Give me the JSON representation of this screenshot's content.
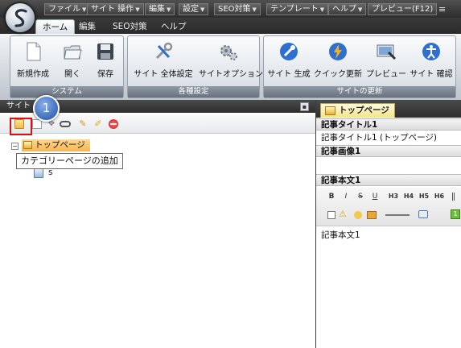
{
  "titlebar": {
    "menus": [
      "ファイル",
      "サイト 操作",
      "編集",
      "設定",
      "SEO対策",
      "テンプレート",
      "ヘルプ",
      "プレビュー(F12)"
    ],
    "overflow": "≡"
  },
  "ribbon_tabs": [
    "ホーム",
    "編集",
    "SEO対策",
    "ヘルプ"
  ],
  "ribbon": {
    "groups": [
      {
        "caption": "システム",
        "buttons": [
          "新規作成",
          "開く",
          "保存"
        ]
      },
      {
        "caption": "各種設定",
        "buttons": [
          "サイト 全体設定",
          "サイトオプション"
        ]
      },
      {
        "caption": "サイトの更新",
        "buttons": [
          "サイト 生成",
          "クイック更新",
          "プレビュー",
          "サイト 確認"
        ]
      }
    ]
  },
  "left_panel": {
    "title": "サイト",
    "tree_root": "トップページ",
    "tree_child": "s",
    "tooltip": "カテゴリーページの追加"
  },
  "annotation": {
    "number": "1"
  },
  "right_panel": {
    "tab": "トップページ",
    "article_title_label": "記事タイトル1",
    "article_title_value": "記事タイトル1 (トップページ)",
    "article_image_label": "記事画像1",
    "article_body_label": "記事本文1",
    "article_body_value": "記事本文1",
    "editor_buttons": [
      "B",
      "I",
      "S",
      "U",
      "H3",
      "H4",
      "H5",
      "H6"
    ]
  },
  "colors": {
    "accent": "#f6b556",
    "highlight_red": "#e01010",
    "annotation_blue": "#3b6bbf"
  }
}
